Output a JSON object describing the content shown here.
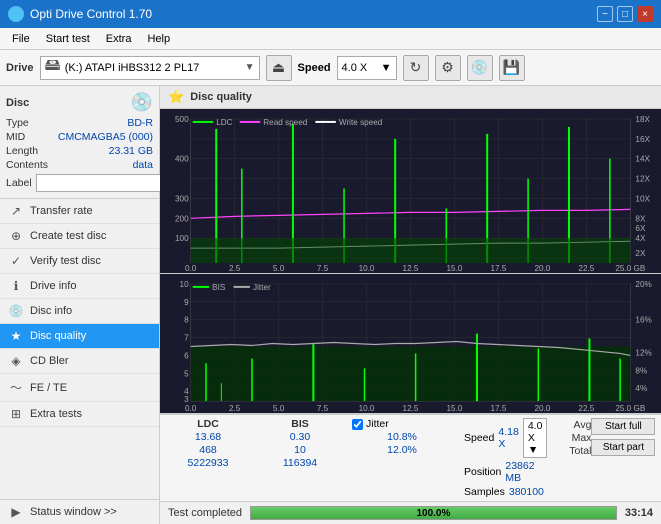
{
  "titlebar": {
    "title": "Opti Drive Control 1.70",
    "min_label": "−",
    "max_label": "□",
    "close_label": "×"
  },
  "menu": {
    "items": [
      "File",
      "Start test",
      "Extra",
      "Help"
    ]
  },
  "toolbar": {
    "drive_label": "Drive",
    "drive_value": "(K:) ATAPI iHBS312 2 PL17",
    "speed_label": "Speed",
    "speed_value": "4.0 X"
  },
  "disc": {
    "type_label": "Type",
    "type_value": "BD-R",
    "mid_label": "MID",
    "mid_value": "CMCMAGBA5 (000)",
    "length_label": "Length",
    "length_value": "23.31 GB",
    "contents_label": "Contents",
    "contents_value": "data",
    "label_label": "Label",
    "label_placeholder": ""
  },
  "nav": {
    "items": [
      {
        "id": "transfer-rate",
        "label": "Transfer rate",
        "icon": "↗"
      },
      {
        "id": "create-test-disc",
        "label": "Create test disc",
        "icon": "⊕"
      },
      {
        "id": "verify-test-disc",
        "label": "Verify test disc",
        "icon": "✓"
      },
      {
        "id": "drive-info",
        "label": "Drive info",
        "icon": "ℹ"
      },
      {
        "id": "disc-info",
        "label": "Disc info",
        "icon": "💿"
      },
      {
        "id": "disc-quality",
        "label": "Disc quality",
        "icon": "★",
        "active": true
      },
      {
        "id": "cd-bler",
        "label": "CD Bler",
        "icon": "◈"
      },
      {
        "id": "fe-te",
        "label": "FE / TE",
        "icon": "〜"
      },
      {
        "id": "extra-tests",
        "label": "Extra tests",
        "icon": "⊞"
      }
    ],
    "status_window": "Status window >>"
  },
  "disc_quality": {
    "title": "Disc quality",
    "chart1": {
      "legend": [
        {
          "label": "LDC",
          "color": "#00ff00"
        },
        {
          "label": "Read speed",
          "color": "#ff00ff"
        },
        {
          "label": "Write speed",
          "color": "#ffffff"
        }
      ],
      "y_max": 500,
      "y_right_labels": [
        "18X",
        "16X",
        "14X",
        "12X",
        "10X",
        "8X",
        "6X",
        "4X",
        "2X"
      ],
      "x_labels": [
        "0.0",
        "2.5",
        "5.0",
        "7.5",
        "10.0",
        "12.5",
        "15.0",
        "17.5",
        "20.0",
        "22.5",
        "25.0 GB"
      ]
    },
    "chart2": {
      "legend": [
        {
          "label": "BIS",
          "color": "#00ff00"
        },
        {
          "label": "Jitter",
          "color": "#ffffff"
        }
      ],
      "y_max": 10,
      "y_right_labels": [
        "20%",
        "16%",
        "12%",
        "8%",
        "4%"
      ],
      "x_labels": [
        "0.0",
        "2.5",
        "5.0",
        "7.5",
        "10.0",
        "12.5",
        "15.0",
        "17.5",
        "20.0",
        "22.5",
        "25.0 GB"
      ]
    },
    "stats": {
      "headers": [
        "LDC",
        "BIS",
        "Jitter",
        "Speed",
        ""
      ],
      "avg_label": "Avg",
      "avg_ldc": "13.68",
      "avg_bis": "0.30",
      "avg_jitter": "10.8%",
      "avg_speed": "4.18 X",
      "max_label": "Max",
      "max_ldc": "468",
      "max_bis": "10",
      "max_jitter": "12.0%",
      "position_label": "Position",
      "position_value": "23862 MB",
      "total_label": "Total",
      "total_ldc": "5222933",
      "total_bis": "116394",
      "samples_label": "Samples",
      "samples_value": "380100",
      "speed_select": "4.0 X",
      "jitter_checked": true,
      "jitter_label": "Jitter"
    },
    "buttons": {
      "start_full": "Start full",
      "start_part": "Start part"
    }
  },
  "statusbar": {
    "status_text": "Test completed",
    "progress": 100,
    "progress_label": "100.0%",
    "time": "33:14"
  }
}
